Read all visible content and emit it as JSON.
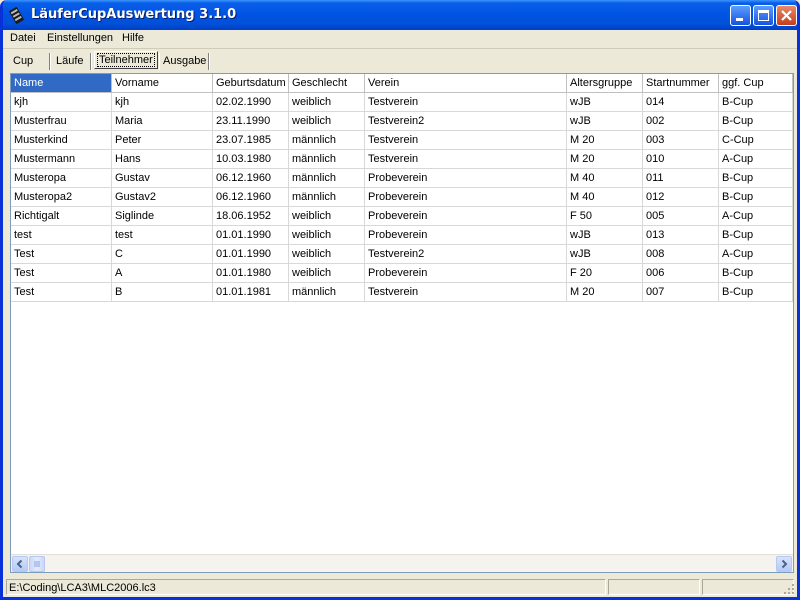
{
  "window": {
    "title": "LäuferCupAuswertung 3.1.0"
  },
  "menu": [
    "Datei",
    "Einstellungen",
    "Hilfe"
  ],
  "tabs": [
    {
      "label": "Cup"
    },
    {
      "label": "Läufe"
    },
    {
      "label": "Teilnehmer",
      "active": true
    },
    {
      "label": "Ausgabe"
    }
  ],
  "table": {
    "columns": [
      "Name",
      "Vorname",
      "Geburtsdatum",
      "Geschlecht",
      "Verein",
      "Altersgruppe",
      "Startnummer",
      "ggf. Cup"
    ],
    "rows": [
      [
        "kjh",
        "kjh",
        "02.02.1990",
        "weiblich",
        "Testverein",
        "wJB",
        "014",
        "B-Cup"
      ],
      [
        "Musterfrau",
        "Maria",
        "23.11.1990",
        "weiblich",
        "Testverein2",
        "wJB",
        "002",
        "B-Cup"
      ],
      [
        "Musterkind",
        "Peter",
        "23.07.1985",
        "männlich",
        "Testverein",
        "M 20",
        "003",
        "C-Cup"
      ],
      [
        "Mustermann",
        "Hans",
        "10.03.1980",
        "männlich",
        "Testverein",
        "M 20",
        "010",
        "A-Cup"
      ],
      [
        "Musteropa",
        "Gustav",
        "06.12.1960",
        "männlich",
        "Probeverein",
        "M 40",
        "011",
        "B-Cup"
      ],
      [
        "Musteropa2",
        "Gustav2",
        "06.12.1960",
        "männlich",
        "Probeverein",
        "M 40",
        "012",
        "B-Cup"
      ],
      [
        "Richtigalt",
        "Siglinde",
        "18.06.1952",
        "weiblich",
        "Probeverein",
        "F 50",
        "005",
        "A-Cup"
      ],
      [
        "test",
        "test",
        "01.01.1990",
        "weiblich",
        "Probeverein",
        "wJB",
        "013",
        "B-Cup"
      ],
      [
        "Test",
        "C",
        "01.01.1990",
        "weiblich",
        "Testverein2",
        "wJB",
        "008",
        "A-Cup"
      ],
      [
        "Test",
        "A",
        "01.01.1980",
        "weiblich",
        "Probeverein",
        "F 20",
        "006",
        "B-Cup"
      ],
      [
        "Test",
        "B",
        "01.01.1981",
        "männlich",
        "Testverein",
        "M 20",
        "007",
        "B-Cup"
      ]
    ]
  },
  "status": {
    "file_path": "E:\\Coding\\LCA3\\MLC2006.lc3",
    "panel2": "",
    "panel3": ""
  },
  "colors": {
    "titlebar": "#0054e3",
    "selection": "#316ac5",
    "face": "#ece9d8"
  }
}
